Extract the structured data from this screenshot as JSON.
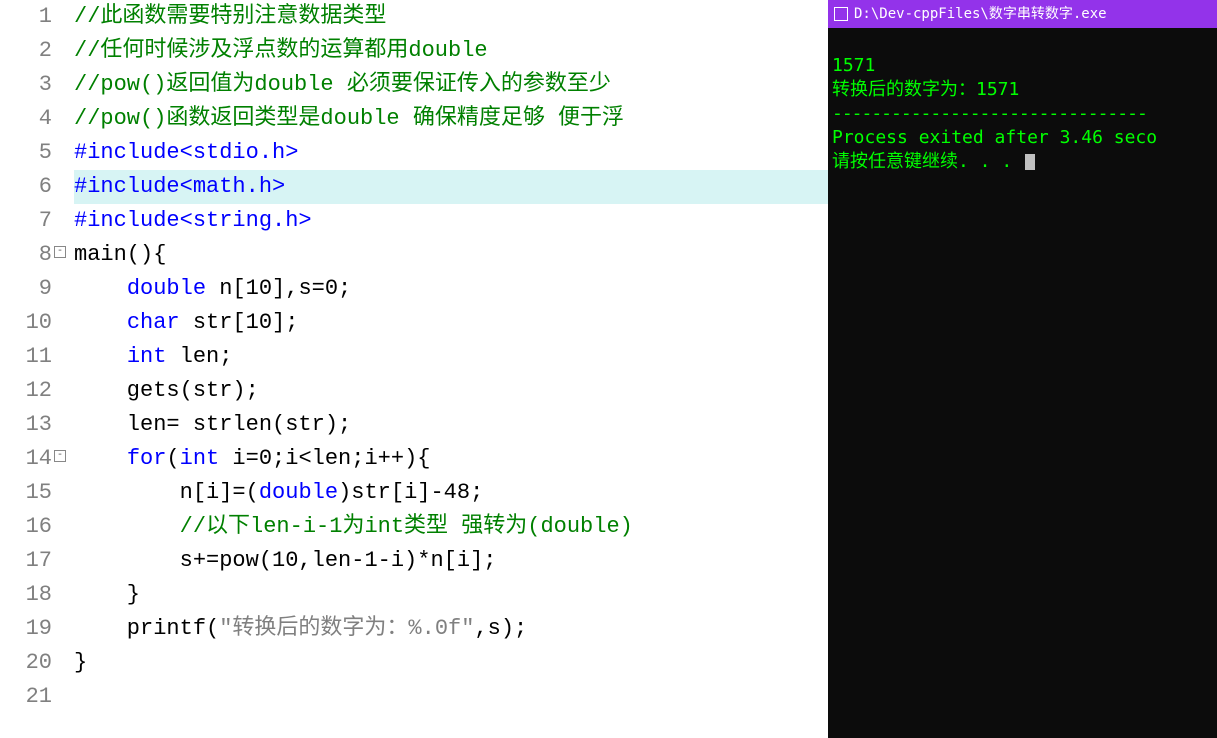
{
  "editor": {
    "lines": [
      {
        "num": "1",
        "fold": "",
        "highlight": false,
        "tokens": [
          {
            "cls": "c-comment",
            "t": "//此函数需要特别注意数据类型"
          }
        ]
      },
      {
        "num": "2",
        "fold": "",
        "highlight": false,
        "tokens": [
          {
            "cls": "c-comment",
            "t": "//任何时候涉及浮点数的运算都用double"
          }
        ]
      },
      {
        "num": "3",
        "fold": "",
        "highlight": false,
        "tokens": [
          {
            "cls": "c-comment",
            "t": "//pow()返回值为double 必须要保证传入的参数至少"
          }
        ]
      },
      {
        "num": "4",
        "fold": "",
        "highlight": false,
        "tokens": [
          {
            "cls": "c-comment",
            "t": "//pow()函数返回类型是double 确保精度足够 便于浮"
          }
        ]
      },
      {
        "num": "5",
        "fold": "",
        "highlight": false,
        "tokens": [
          {
            "cls": "c-preproc",
            "t": "#include<stdio.h>"
          }
        ]
      },
      {
        "num": "6",
        "fold": "",
        "highlight": true,
        "tokens": [
          {
            "cls": "c-preproc",
            "t": "#include<math.h>"
          }
        ]
      },
      {
        "num": "7",
        "fold": "",
        "highlight": false,
        "tokens": [
          {
            "cls": "c-preproc",
            "t": "#include<string.h>"
          }
        ]
      },
      {
        "num": "8",
        "fold": "-",
        "highlight": false,
        "tokens": [
          {
            "cls": "c-plain",
            "t": "main(){"
          }
        ]
      },
      {
        "num": "9",
        "fold": "",
        "highlight": false,
        "tokens": [
          {
            "cls": "c-plain",
            "t": "    "
          },
          {
            "cls": "c-type",
            "t": "double"
          },
          {
            "cls": "c-plain",
            "t": " n[10],s=0;"
          }
        ]
      },
      {
        "num": "10",
        "fold": "",
        "highlight": false,
        "tokens": [
          {
            "cls": "c-plain",
            "t": "    "
          },
          {
            "cls": "c-type",
            "t": "char"
          },
          {
            "cls": "c-plain",
            "t": " str[10];"
          }
        ]
      },
      {
        "num": "11",
        "fold": "",
        "highlight": false,
        "tokens": [
          {
            "cls": "c-plain",
            "t": "    "
          },
          {
            "cls": "c-type",
            "t": "int"
          },
          {
            "cls": "c-plain",
            "t": " len;"
          }
        ]
      },
      {
        "num": "12",
        "fold": "",
        "highlight": false,
        "tokens": [
          {
            "cls": "c-plain",
            "t": "    gets(str);"
          }
        ]
      },
      {
        "num": "13",
        "fold": "",
        "highlight": false,
        "tokens": [
          {
            "cls": "c-plain",
            "t": "    len= strlen(str);"
          }
        ]
      },
      {
        "num": "14",
        "fold": "-",
        "highlight": false,
        "tokens": [
          {
            "cls": "c-plain",
            "t": "    "
          },
          {
            "cls": "c-keyword",
            "t": "for"
          },
          {
            "cls": "c-plain",
            "t": "("
          },
          {
            "cls": "c-type",
            "t": "int"
          },
          {
            "cls": "c-plain",
            "t": " i=0;i<len;i++){"
          }
        ]
      },
      {
        "num": "15",
        "fold": "",
        "highlight": false,
        "tokens": [
          {
            "cls": "c-plain",
            "t": "        n[i]=("
          },
          {
            "cls": "c-type",
            "t": "double"
          },
          {
            "cls": "c-plain",
            "t": ")str[i]-48;"
          }
        ]
      },
      {
        "num": "16",
        "fold": "",
        "highlight": false,
        "tokens": [
          {
            "cls": "c-plain",
            "t": "        "
          },
          {
            "cls": "c-comment",
            "t": "//以下len-i-1为int类型 强转为(double)"
          }
        ]
      },
      {
        "num": "17",
        "fold": "",
        "highlight": false,
        "tokens": [
          {
            "cls": "c-plain",
            "t": "        s+=pow(10,len-1-i)*n[i];"
          }
        ]
      },
      {
        "num": "18",
        "fold": "",
        "highlight": false,
        "tokens": [
          {
            "cls": "c-plain",
            "t": "    }"
          }
        ]
      },
      {
        "num": "19",
        "fold": "",
        "highlight": false,
        "tokens": [
          {
            "cls": "c-plain",
            "t": "    printf("
          },
          {
            "cls": "c-string",
            "t": "\"转换后的数字为：%.0f\""
          },
          {
            "cls": "c-plain",
            "t": ",s);"
          }
        ]
      },
      {
        "num": "20",
        "fold": "",
        "highlight": false,
        "tokens": [
          {
            "cls": "c-plain",
            "t": "}"
          }
        ]
      },
      {
        "num": "21",
        "fold": "",
        "highlight": false,
        "tokens": [
          {
            "cls": "c-plain",
            "t": ""
          }
        ]
      }
    ]
  },
  "console": {
    "title": "D:\\Dev-cppFiles\\数字串转数字.exe",
    "line1": "1571",
    "line2": "转换后的数字为：1571",
    "hr": "--------------------------------",
    "line3": "Process exited after 3.46 seco",
    "line4": "请按任意键继续. . . "
  }
}
